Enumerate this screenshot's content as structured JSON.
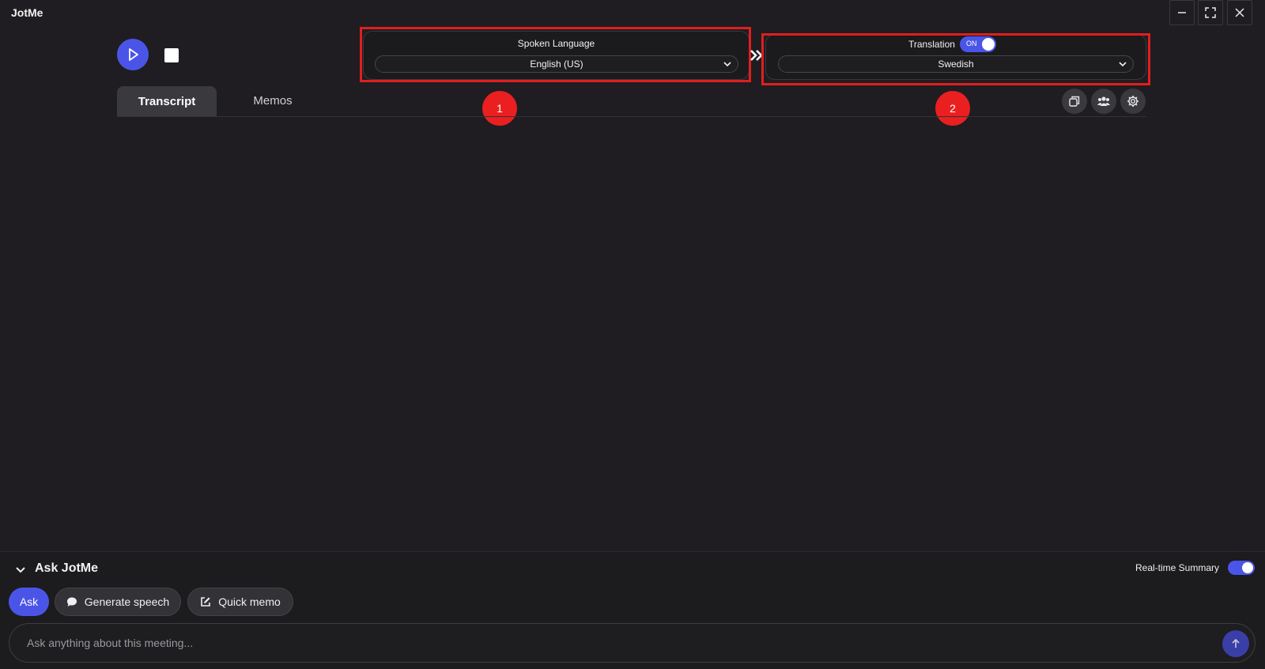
{
  "app": {
    "title": "JotMe"
  },
  "window_controls": [
    "minimize-icon",
    "fullscreen-icon",
    "close-icon"
  ],
  "spoken_language": {
    "label": "Spoken Language",
    "value": "English (US)"
  },
  "translation": {
    "label": "Translation",
    "toggle_text": "ON",
    "enabled": true,
    "value": "Swedish"
  },
  "annotations": {
    "badge1": "1",
    "badge2": "2",
    "frame_color": "#e01e1e"
  },
  "tabs": [
    {
      "label": "Transcript",
      "active": true
    },
    {
      "label": "Memos",
      "active": false
    }
  ],
  "tools": [
    "copy-icon",
    "people-icon",
    "gear-icon"
  ],
  "ask_panel": {
    "title": "Ask JotMe",
    "realtime_summary_label": "Real-time Summary",
    "realtime_summary_enabled": true,
    "buttons": {
      "ask": "Ask",
      "generate_speech": "Generate speech",
      "quick_memo": "Quick memo"
    },
    "input_placeholder": "Ask anything about this meeting..."
  },
  "colors": {
    "accent": "#4a55e8",
    "background": "#1f1d21",
    "badge": "#ea2020"
  }
}
